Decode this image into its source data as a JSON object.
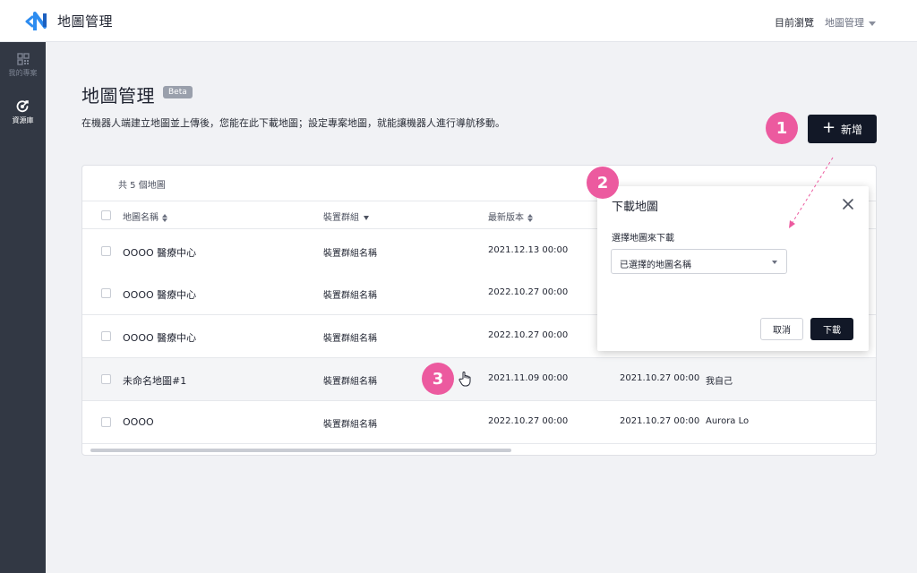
{
  "header": {
    "app_title": "地圖管理",
    "nav_current": "目前瀏覽",
    "nav_menu": "地圖管理"
  },
  "sidebar": {
    "items": [
      {
        "label": "我的專案",
        "icon": "grid-icon",
        "active": false
      },
      {
        "label": "資源庫",
        "icon": "resource-icon",
        "active": true
      }
    ]
  },
  "page": {
    "title": "地圖管理",
    "badge": "Beta",
    "description": "在機器人端建立地圖並上傳後，您能在此下載地圖；設定專案地圖，就能讓機器人進行導航移動。",
    "add_button": "新增"
  },
  "callouts": [
    "1",
    "2",
    "3"
  ],
  "table": {
    "count_label": "共 5 個地圖",
    "headers": {
      "name": "地圖名稱",
      "group": "裝置群組",
      "version": "最新版本"
    },
    "rows": [
      {
        "name": "OOOO 醫療中心",
        "group": "裝置群組名稱",
        "version": "2021.12.13  00:00",
        "updated": "",
        "owner": ""
      },
      {
        "name": "OOOO 醫療中心",
        "group": "裝置群組名稱",
        "version": "2022.10.27  00:00",
        "updated": "",
        "owner": ""
      },
      {
        "name": "OOOO 醫療中心",
        "group": "裝置群組名稱",
        "version": "2022.10.27  00:00",
        "updated": "",
        "owner": ""
      },
      {
        "name": "未命名地圖#1",
        "group": "裝置群組名稱",
        "version": "2021.11.09  00:00",
        "updated": "2021.10.27  00:00",
        "owner": "我自己"
      },
      {
        "name": "OOOO",
        "group": "裝置群組名稱",
        "version": "2022.10.27  00:00",
        "updated": "2021.10.27  00:00",
        "owner": "Aurora Lo"
      }
    ]
  },
  "modal": {
    "title": "下載地圖",
    "field_label": "選擇地圖來下載",
    "select_value": "已選擇的地圖名稱",
    "cancel_label": "取消",
    "confirm_label": "下載"
  },
  "colors": {
    "accent_pink": "#ec5a9f",
    "primary_dark": "#121827",
    "sidebar": "#323844"
  }
}
